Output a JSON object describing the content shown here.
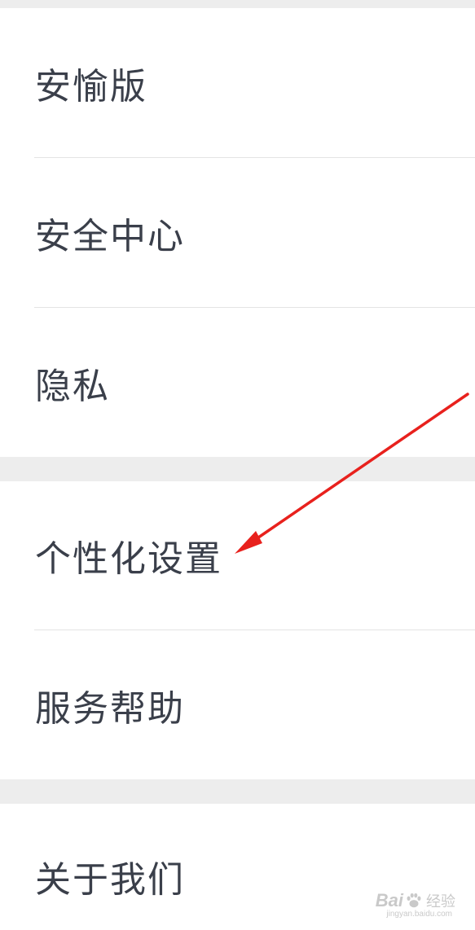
{
  "settings": {
    "groups": [
      {
        "items": [
          {
            "label": "安愉版"
          },
          {
            "label": "安全中心"
          },
          {
            "label": "隐私"
          }
        ]
      },
      {
        "items": [
          {
            "label": "个性化设置"
          },
          {
            "label": "服务帮助"
          }
        ]
      },
      {
        "items": [
          {
            "label": "关于我们"
          }
        ]
      }
    ]
  },
  "annotation": {
    "arrow_color": "#e8211d",
    "points_to": "个性化设置"
  },
  "watermark": {
    "brand": "Bai",
    "brand_suffix": "经验",
    "url": "jingyan.baidu.com"
  }
}
